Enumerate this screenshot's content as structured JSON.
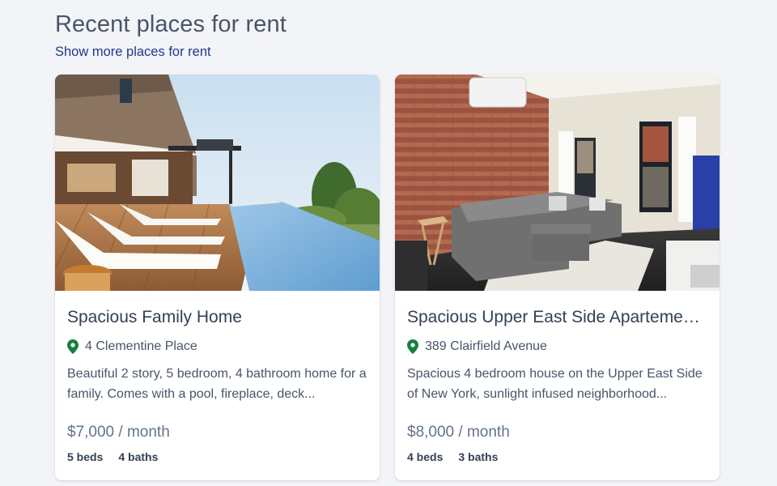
{
  "section": {
    "title": "Recent places for rent",
    "more_link": "Show more places for rent"
  },
  "listings": [
    {
      "title": "Spacious Family Home",
      "address": "4 Clementine Place",
      "description": "Beautiful 2 story, 5 bedroom, 4 bathroom home for a family. Comes with a pool, fireplace, deck...",
      "price": "$7,000 / month",
      "beds": "5 beds",
      "baths": "4 baths",
      "photo_icon": "house-with-pool-photo"
    },
    {
      "title": "Spacious Upper East Side Apartement in NYC",
      "address": "389 Clairfield Avenue",
      "description": "Spacious 4 bedroom house on the Upper East Side of New York, sunlight infused neighborhood...",
      "price": "$8,000 / month",
      "beds": "4 beds",
      "baths": "3 baths",
      "photo_icon": "brick-wall-living-room-photo"
    }
  ],
  "colors": {
    "pin": "#15803d",
    "link": "#1e3a8a",
    "background": "#f3f4f8"
  }
}
